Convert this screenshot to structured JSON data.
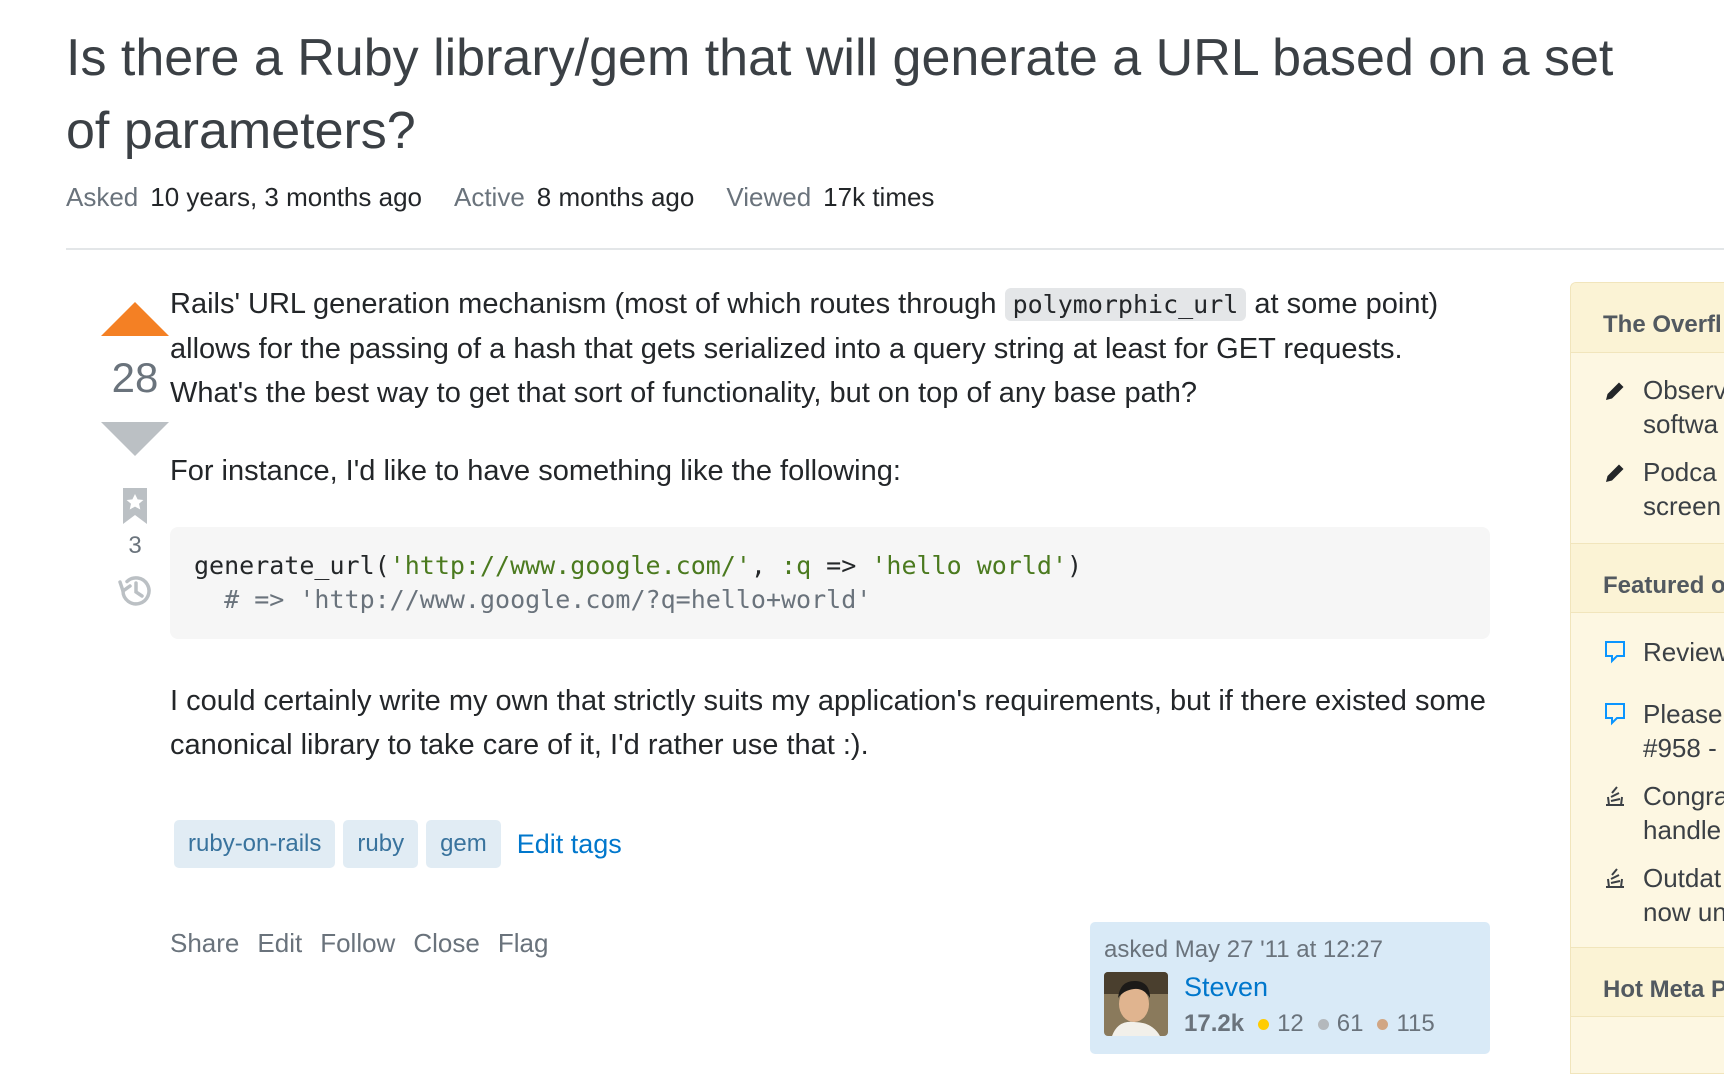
{
  "question": {
    "title": "Is there a Ruby library/gem that will generate a URL based on a set of parameters?",
    "meta": [
      {
        "label": "Asked",
        "value": "10 years, 3 months ago"
      },
      {
        "label": "Active",
        "value": "8 months ago"
      },
      {
        "label": "Viewed",
        "value": "17k times"
      }
    ],
    "score": "28",
    "bookmark_count": "3",
    "body": {
      "p1_before": "Rails' URL generation mechanism (most of which routes through ",
      "p1_code": "polymorphic_url",
      "p1_after": " at some point) allows for the passing of a hash that gets serialized into a query string at least for GET requests. What's the best way to get that sort of functionality, but on top of any base path?",
      "p2": "For instance, I'd like to have something like the following:",
      "code_fn": "generate_url(",
      "code_str1": "'http://www.google.com/'",
      "code_sep": ", ",
      "code_sym": ":q",
      "code_arrow": " => ",
      "code_str2": "'hello world'",
      "code_close": ")",
      "code_comment": "  # => 'http://www.google.com/?q=hello+world'",
      "p3": "I could certainly write my own that strictly suits my application's requirements, but if there existed some canonical library to take care of it, I'd rather use that :)."
    },
    "tags": [
      "ruby-on-rails",
      "ruby",
      "gem"
    ],
    "edit_tags_label": "Edit tags",
    "actions": [
      "Share",
      "Edit",
      "Follow",
      "Close",
      "Flag"
    ]
  },
  "owner": {
    "asked_text": "asked May 27 '11 at 12:27",
    "name": "Steven",
    "reputation": "17.2k",
    "badges": [
      {
        "count": "12",
        "color": "#ffcc01"
      },
      {
        "count": "61",
        "color": "#b4b8bc"
      },
      {
        "count": "115",
        "color": "#d1a684"
      }
    ]
  },
  "sidebar": {
    "sections": [
      {
        "title": "The Overfl",
        "items": [
          {
            "icon": "pencil-icon",
            "lines": [
              "Observ",
              "softwa"
            ]
          },
          {
            "icon": "pencil-icon",
            "lines": [
              "Podca",
              "screen"
            ]
          }
        ]
      },
      {
        "title": "Featured o",
        "items": [
          {
            "icon": "speech-bubble-icon",
            "lines": [
              "Review"
            ]
          },
          {
            "icon": "speech-bubble-icon",
            "lines": [
              "Please",
              "#958 -"
            ]
          },
          {
            "icon": "stack-exchange-icon",
            "lines": [
              "Congra",
              "handle"
            ]
          },
          {
            "icon": "stack-exchange-icon",
            "lines": [
              "Outdat",
              "now un"
            ]
          }
        ]
      },
      {
        "title": "Hot Meta P",
        "items": []
      }
    ]
  },
  "colors": {
    "upvote": "#f48024",
    "link": "#0077cc",
    "tag_bg": "#e1ecf4",
    "sidebar_bg": "#fdf7e2"
  }
}
